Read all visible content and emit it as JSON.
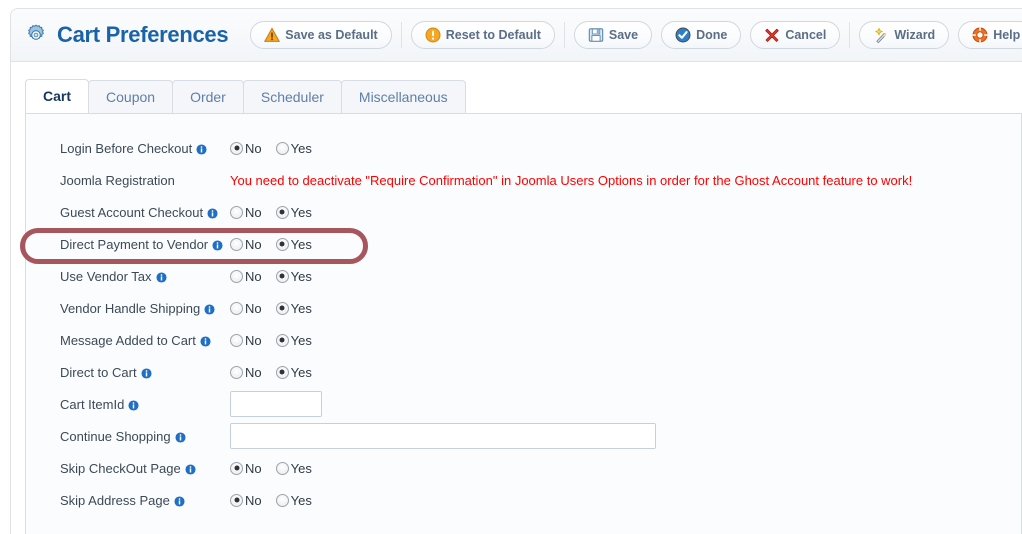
{
  "header": {
    "title": "Cart Preferences",
    "gear_icon": "gear-icon"
  },
  "toolbar": {
    "buttons": [
      {
        "label": "Save as Default",
        "icon": "warning-triangle-icon"
      },
      {
        "label": "Reset to Default",
        "icon": "exclamation-circle-icon"
      },
      {
        "label": "Save",
        "icon": "floppy-disk-icon"
      },
      {
        "label": "Done",
        "icon": "check-circle-icon"
      },
      {
        "label": "Cancel",
        "icon": "red-x-icon"
      },
      {
        "label": "Wizard",
        "icon": "magic-wand-icon"
      },
      {
        "label": "Help",
        "icon": "lifebuoy-icon"
      }
    ]
  },
  "tabs": [
    {
      "label": "Cart",
      "active": true
    },
    {
      "label": "Coupon",
      "active": false
    },
    {
      "label": "Order",
      "active": false
    },
    {
      "label": "Scheduler",
      "active": false
    },
    {
      "label": "Miscellaneous",
      "active": false
    }
  ],
  "radio_options": {
    "no": "No",
    "yes": "Yes"
  },
  "form": {
    "rows": [
      {
        "label": "Login Before Checkout",
        "info": true,
        "type": "radio",
        "value": "No"
      },
      {
        "label": "Joomla Registration",
        "info": false,
        "type": "warning",
        "warning": "You need to deactivate \"Require Confirmation\" in Joomla Users Options in order for the Ghost Account feature to work!"
      },
      {
        "label": "Guest Account Checkout",
        "info": true,
        "type": "radio",
        "value": "Yes"
      },
      {
        "label": "Direct Payment to Vendor",
        "info": true,
        "type": "radio",
        "value": "Yes",
        "highlighted": true
      },
      {
        "label": "Use Vendor Tax",
        "info": true,
        "type": "radio",
        "value": "Yes"
      },
      {
        "label": "Vendor Handle Shipping",
        "info": true,
        "type": "radio",
        "value": "Yes"
      },
      {
        "label": "Message Added to Cart",
        "info": true,
        "type": "radio",
        "value": "Yes"
      },
      {
        "label": "Direct to Cart",
        "info": true,
        "type": "radio",
        "value": "Yes"
      },
      {
        "label": "Cart ItemId",
        "info": true,
        "type": "text-small",
        "value": "",
        "placeholder": ""
      },
      {
        "label": "Continue Shopping",
        "info": true,
        "type": "text-wide",
        "value": "",
        "placeholder": ""
      },
      {
        "label": "Skip CheckOut Page",
        "info": true,
        "type": "radio",
        "value": "No"
      },
      {
        "label": "Skip Address Page",
        "info": true,
        "type": "radio",
        "value": "No"
      }
    ]
  },
  "colors": {
    "title_blue": "#1b63a8",
    "button_text": "#5a6e86",
    "warning_red": "#ff0000",
    "annotation_red": "#a14850",
    "active_tab_text": "#17375e"
  }
}
